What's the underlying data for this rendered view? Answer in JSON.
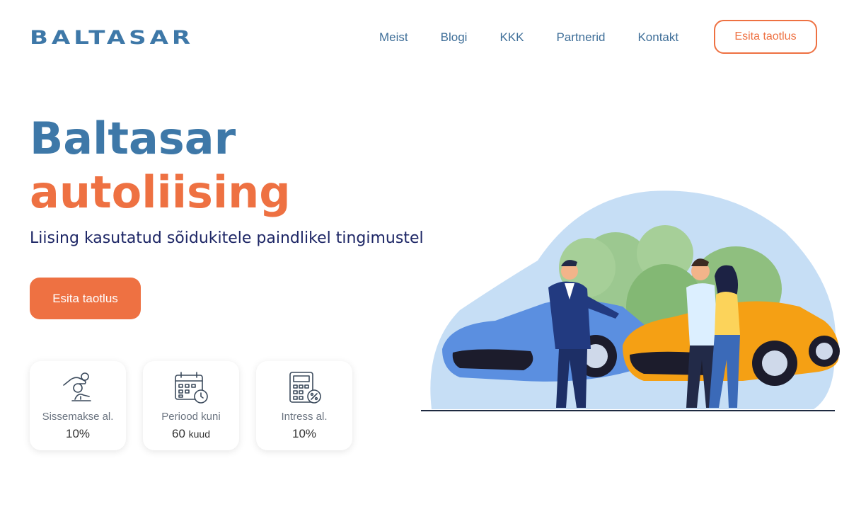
{
  "brand": {
    "logo_text": "BALTASAR"
  },
  "nav": {
    "items": [
      "Meist",
      "Blogi",
      "KKK",
      "Partnerid",
      "Kontakt"
    ],
    "cta_label": "Esita taotlus"
  },
  "hero": {
    "title_line1": "Baltasar",
    "title_line2": "autoliising",
    "subtitle": "Liising kasutatud sõidukitele paindlikel tingimustel",
    "cta_label": "Esita taotlus"
  },
  "cards": [
    {
      "icon": "hand-coins-icon",
      "label": "Sissemakse al.",
      "value": "10%",
      "unit": ""
    },
    {
      "icon": "calendar-clock-icon",
      "label": "Periood kuni",
      "value": "60",
      "unit": "kuud"
    },
    {
      "icon": "calculator-percent-icon",
      "label": "Intress al.",
      "value": "10%",
      "unit": ""
    }
  ],
  "colors": {
    "primary": "#3e78a8",
    "accent": "#ee7142",
    "dark_text": "#1e2766"
  }
}
